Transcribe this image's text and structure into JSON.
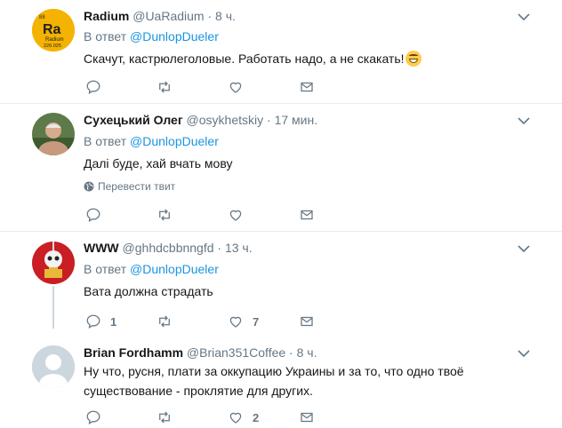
{
  "tweets": [
    {
      "name": "Radium",
      "handle": "@UaRadium",
      "dot": "·",
      "time": "8 ч.",
      "reply_prefix": "В ответ",
      "reply_to": "@DunlopDueler",
      "text": "Скачут, кастрюлеголовые. Работать надо, а не скакать!",
      "avatar": {
        "symbol": "Ra",
        "element_name": "Radium",
        "mass": "226.025",
        "number": "88",
        "color": "#f5b301"
      },
      "reply_count": "",
      "retweet_count": "",
      "like_count": ""
    },
    {
      "name": "Сухецький Олег",
      "handle": "@osykhetskiy",
      "dot": "·",
      "time": "17 мин.",
      "reply_prefix": "В ответ",
      "reply_to": "@DunlopDueler",
      "text": "Далі буде, хай вчать мову",
      "translate": "Перевести твит",
      "reply_count": "",
      "retweet_count": "",
      "like_count": ""
    },
    {
      "name": "WWW",
      "handle": "@ghhdcbbnngfd",
      "dot": "·",
      "time": "13 ч.",
      "reply_prefix": "В ответ",
      "reply_to": "@DunlopDueler",
      "text": "Вата должна страдать",
      "reply_count": "1",
      "retweet_count": "",
      "like_count": "7"
    },
    {
      "name": "Brian Fordhamm",
      "handle": "@Brian351Coffee",
      "dot": "·",
      "time": "8 ч.",
      "text": "Ну что, русня, плати за оккупацию Украины и за то, что одно твоё существование - проклятие для других.",
      "reply_count": "",
      "retweet_count": "",
      "like_count": "2"
    }
  ],
  "colors": {
    "link": "#1b95e0",
    "muted": "#657786",
    "separator": "#e6ecf0",
    "thread_line": "#ccd6dd"
  },
  "icons": [
    "reply-icon",
    "retweet-icon",
    "like-icon",
    "message-icon",
    "caret-down-icon",
    "globe-icon"
  ]
}
